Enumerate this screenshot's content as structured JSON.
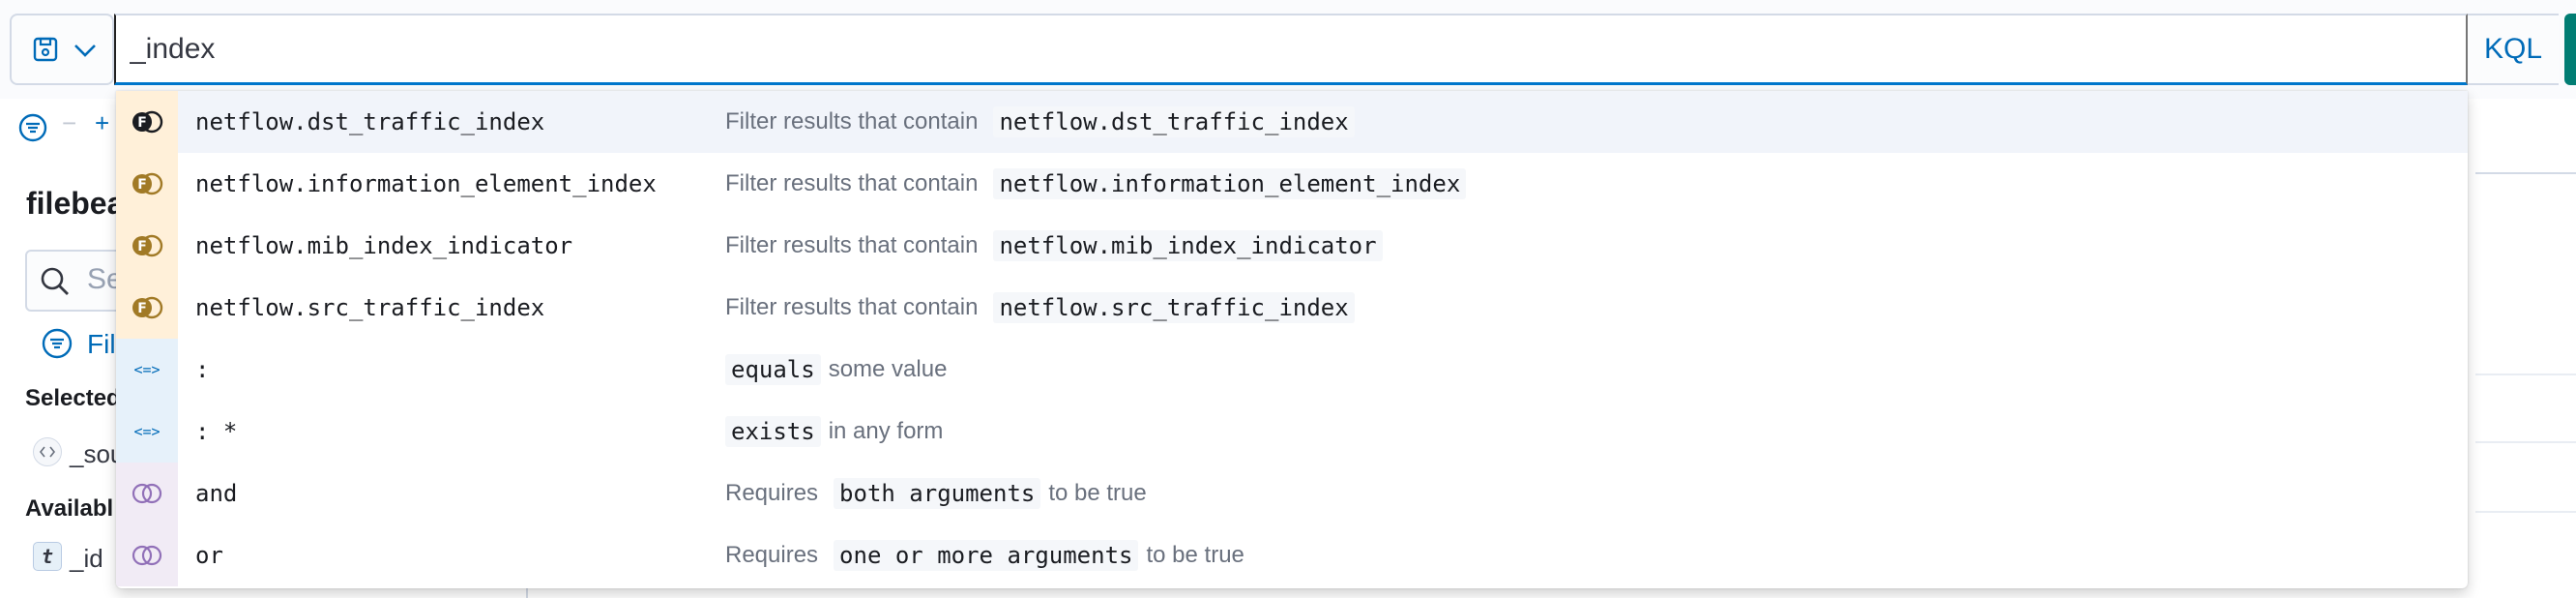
{
  "query": {
    "value": "_index"
  },
  "toolbar": {
    "language_label": "KQL"
  },
  "sidebar": {
    "index_title_fragment": "filebea",
    "search_fragment": "Se",
    "filter_fragment": "Fil",
    "selected_fragment": "Selected",
    "source_fragment": "_sou",
    "available_fragment": "Availabl",
    "id_field": "_id",
    "id_type_letter": "t"
  },
  "suggestions": [
    {
      "kind": "field",
      "label": "netflow.dst_traffic_index",
      "desc_prefix": "Filter results that contain",
      "chip": "netflow.dst_traffic_index",
      "desc_suffix": ""
    },
    {
      "kind": "field",
      "label": "netflow.information_element_index",
      "desc_prefix": "Filter results that contain",
      "chip": "netflow.information_element_index",
      "desc_suffix": ""
    },
    {
      "kind": "field",
      "label": "netflow.mib_index_indicator",
      "desc_prefix": "Filter results that contain",
      "chip": "netflow.mib_index_indicator",
      "desc_suffix": ""
    },
    {
      "kind": "field",
      "label": "netflow.src_traffic_index",
      "desc_prefix": "Filter results that contain",
      "chip": "netflow.src_traffic_index",
      "desc_suffix": ""
    },
    {
      "kind": "operator",
      "label": ":",
      "desc_prefix": "",
      "chip": "equals",
      "desc_suffix": "some value"
    },
    {
      "kind": "operator",
      "label": ": *",
      "desc_prefix": "",
      "chip": "exists",
      "desc_suffix": "in any form"
    },
    {
      "kind": "conjunction",
      "label": "and",
      "desc_prefix": "Requires",
      "chip": "both arguments",
      "desc_suffix": "to be true"
    },
    {
      "kind": "conjunction",
      "label": "or",
      "desc_prefix": "Requires",
      "chip": "one or more arguments",
      "desc_suffix": "to be true"
    }
  ],
  "icons": {
    "field": "field-suggestion-icon",
    "operator": "operator-icon",
    "conjunction": "conjunction-icon"
  },
  "colors": {
    "accent": "#0077cc",
    "field_badge": "#a17a26",
    "operator_badge": "#006bb8",
    "conjunction_badge": "#9170b8"
  }
}
